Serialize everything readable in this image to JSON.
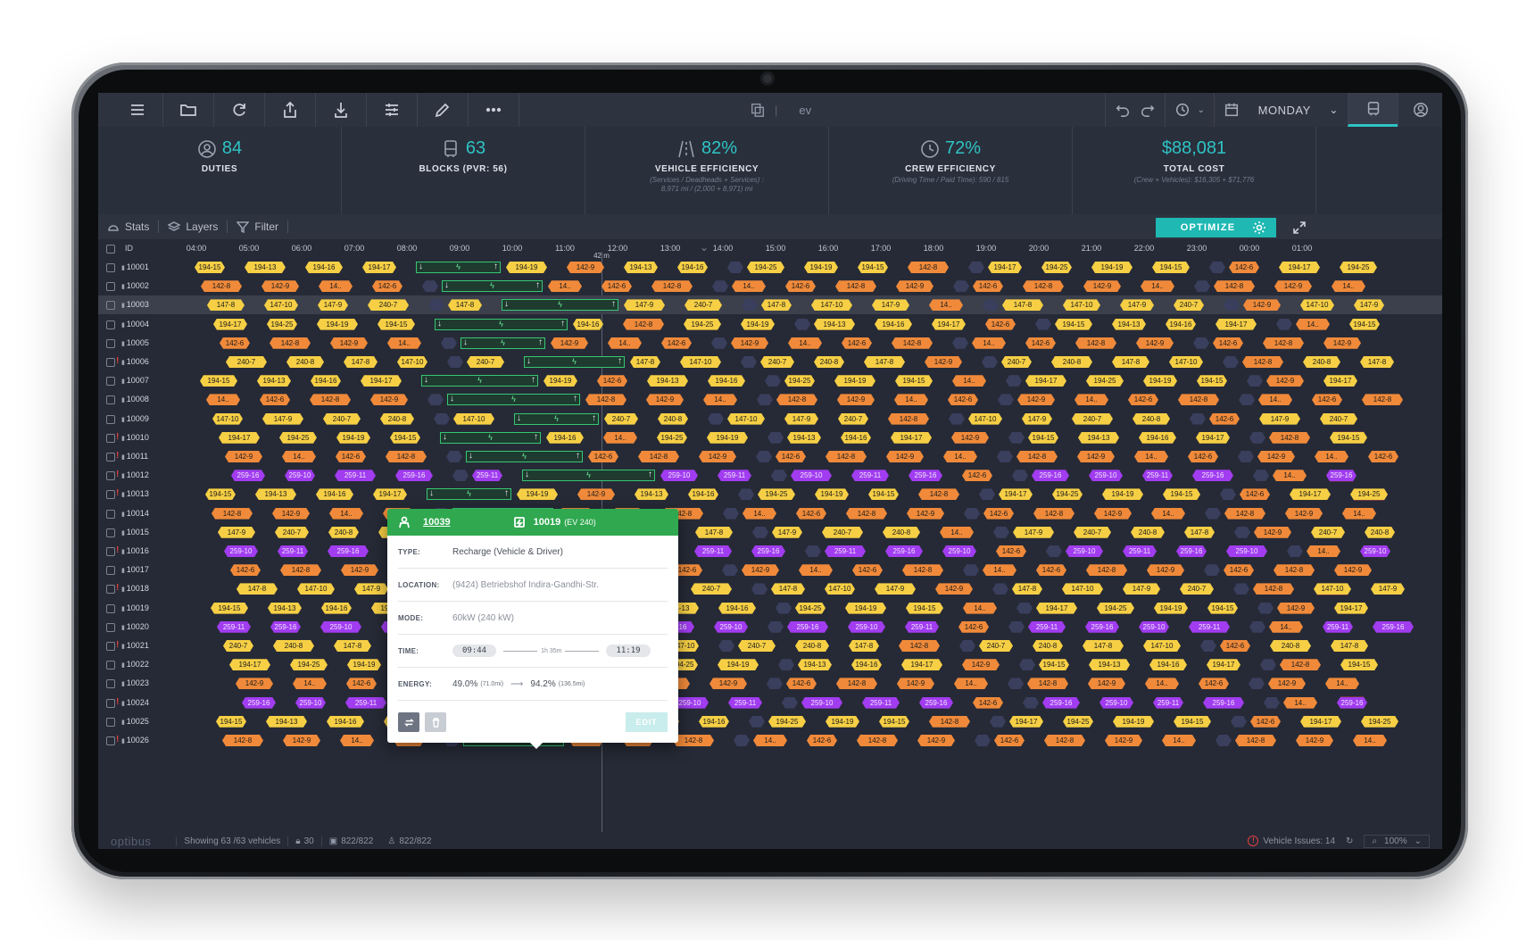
{
  "topbar": {
    "buttons": [
      "menu-icon",
      "folder-icon",
      "refresh-icon",
      "share-icon",
      "download-icon",
      "sliders-icon",
      "pencil-icon",
      "more-icon"
    ],
    "dataset_icon": "copy-icon",
    "dataset_name": "ev",
    "day": "MONDAY"
  },
  "stats": [
    {
      "icon": "user-circle-icon",
      "value": "84",
      "label": "DUTIES",
      "sub": ""
    },
    {
      "icon": "bus-icon",
      "value": "63",
      "label": "BLOCKS (PVR: 56)",
      "sub": ""
    },
    {
      "icon": "road-icon",
      "value": "82%",
      "label": "VEHICLE EFFICIENCY",
      "sub": "(Services / Deadheads + Services) :",
      "sub2": "8,971 mi / (2,000 + 8,971) mi"
    },
    {
      "icon": "clock-icon",
      "value": "72%",
      "label": "CREW EFFICIENCY",
      "sub": "(Driving Time / Paid Time): 590 / 815",
      "sub2": ""
    },
    {
      "icon": "",
      "value": "$88,081",
      "label": "TOTAL COST",
      "sub": "(Crew + Vehicles): $16,305 + $71,776",
      "sub2": ""
    }
  ],
  "toolbar": {
    "stats_label": "Stats",
    "layers_label": "Layers",
    "filter_label": "Filter",
    "optimize_label": "OPTIMIZE"
  },
  "axis": {
    "id_label": "ID",
    "ticks": [
      "04:00",
      "05:00",
      "06:00",
      "07:00",
      "08:00",
      "09:00",
      "10:00",
      "11:00",
      "12:00",
      "13:00",
      "14:00",
      "15:00",
      "16:00",
      "17:00",
      "18:00",
      "19:00",
      "20:00",
      "21:00",
      "22:00",
      "23:00",
      "00:00",
      "01:00"
    ],
    "now_label": "42 m"
  },
  "rows": [
    {
      "id": "10001",
      "flag": false
    },
    {
      "id": "10002",
      "flag": false
    },
    {
      "id": "10003",
      "flag": false,
      "highlight": true
    },
    {
      "id": "10004",
      "flag": false
    },
    {
      "id": "10005",
      "flag": false
    },
    {
      "id": "10006",
      "flag": true
    },
    {
      "id": "10007",
      "flag": false
    },
    {
      "id": "10008",
      "flag": false
    },
    {
      "id": "10009",
      "flag": false
    },
    {
      "id": "10010",
      "flag": true
    },
    {
      "id": "10011",
      "flag": true
    },
    {
      "id": "10012",
      "flag": true
    },
    {
      "id": "10013",
      "flag": true
    },
    {
      "id": "10014",
      "flag": false
    },
    {
      "id": "10015",
      "flag": false
    },
    {
      "id": "10016",
      "flag": true
    },
    {
      "id": "10017",
      "flag": false
    },
    {
      "id": "10018",
      "flag": true
    },
    {
      "id": "10019",
      "flag": false
    },
    {
      "id": "10020",
      "flag": false
    },
    {
      "id": "10021",
      "flag": true
    },
    {
      "id": "10022",
      "flag": false
    },
    {
      "id": "10023",
      "flag": false
    },
    {
      "id": "10024",
      "flag": true
    },
    {
      "id": "10025",
      "flag": false
    },
    {
      "id": "10026",
      "flag": true
    }
  ],
  "colors": {
    "yellow": "#f6cf45",
    "orange": "#f08a3a",
    "purple": "#a13cf0",
    "charge": "#36c774",
    "accent": "#2ec4c4"
  },
  "popup": {
    "duty_id": "10039",
    "vehicle_id": "10019",
    "vehicle_model": "(EV 240)",
    "type_label": "TYPE:",
    "type_value": "Recharge (Vehicle & Driver)",
    "location_label": "LOCATION:",
    "location_value": "(9424) Betriebshof Indira-Gandhi-Str.",
    "mode_label": "MODE:",
    "mode_value": "60kW (240 kW)",
    "time_label": "TIME:",
    "time_start": "09:44",
    "time_duration": "1h 35m",
    "time_end": "11:19",
    "energy_label": "ENERGY:",
    "energy_start": "49.0%",
    "energy_start_mi": "(71.0mi)",
    "energy_end": "94.2%",
    "energy_end_mi": "(136.5mi)",
    "edit_label": "EDIT"
  },
  "footer": {
    "brand": "optibus",
    "showing": "Showing 63 /63 vehicles",
    "locks": "30",
    "vehicles_count": "822/822",
    "crew_count": "822/822",
    "issues": "Vehicle Issues: 14",
    "zoom": "100%"
  }
}
